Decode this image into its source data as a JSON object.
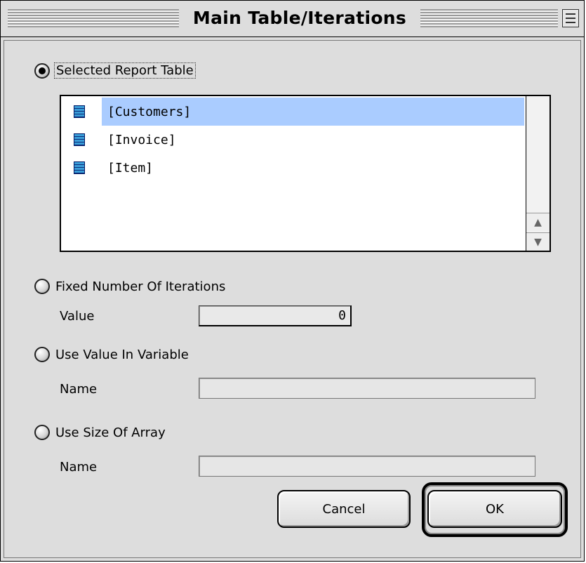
{
  "window": {
    "title": "Main Table/Iterations"
  },
  "options": {
    "selected_report_table": "Selected Report Table",
    "fixed_number": "Fixed Number Of Iterations",
    "use_variable": "Use Value In Variable",
    "use_array": "Use Size Of Array",
    "selected": "selected_report_table"
  },
  "tables": [
    {
      "label": "[Customers]",
      "selected": true
    },
    {
      "label": "[Invoice]",
      "selected": false
    },
    {
      "label": "[Item]",
      "selected": false
    }
  ],
  "fields": {
    "value_label": "Value",
    "value": "0",
    "variable_name_label": "Name",
    "variable_name_value": "",
    "array_name_label": "Name",
    "array_name_value": ""
  },
  "buttons": {
    "cancel": "Cancel",
    "ok": "OK"
  },
  "icons": {
    "table": "table-icon",
    "collapse": "window-collapse-icon",
    "scroll_up": "scroll-up-arrow-icon",
    "scroll_down": "scroll-down-arrow-icon"
  },
  "colors": {
    "selection": "#aaccff",
    "table_icon_light": "#3a9dd8",
    "table_icon_dark": "#0a2a78"
  }
}
